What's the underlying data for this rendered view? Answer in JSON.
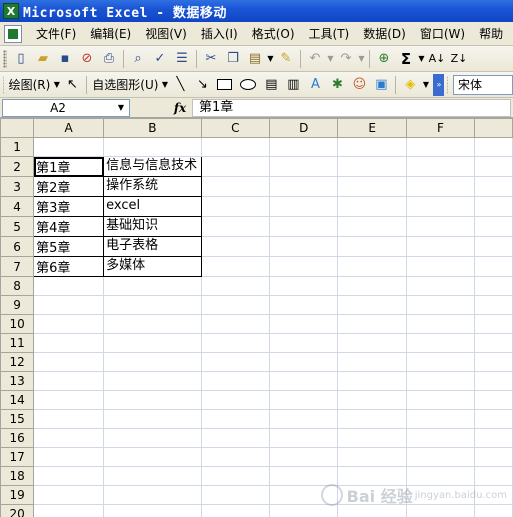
{
  "window": {
    "title": "Microsoft Excel - 数据移动",
    "app_icon": "excel-icon"
  },
  "menu": {
    "items": [
      "文件(F)",
      "编辑(E)",
      "视图(V)",
      "插入(I)",
      "格式(O)",
      "工具(T)",
      "数据(D)",
      "窗口(W)",
      "帮助"
    ]
  },
  "toolbar_standard": {
    "icons": [
      "new-icon",
      "open-icon",
      "save-icon",
      "permission-icon",
      "print-icon",
      "print-preview-icon",
      "spelling-icon",
      "research-icon",
      "cut-icon",
      "copy-icon",
      "paste-icon",
      "format-painter-icon",
      "undo-icon",
      "redo-icon",
      "hyperlink-icon",
      "autosum-icon",
      "sort-ascending-icon",
      "sort-descending-icon"
    ],
    "autosum_glyph": "Σ"
  },
  "toolbar_drawing": {
    "draw_label": "绘图(R)",
    "autoshapes_label": "自选图形(U)",
    "font_name": "宋体"
  },
  "formula_bar": {
    "name_box": "A2",
    "fx": "fx",
    "content": "第1章"
  },
  "sheet": {
    "columns": [
      "A",
      "B",
      "C",
      "D",
      "E",
      "F"
    ],
    "rows": [
      {
        "num": "1",
        "a": "",
        "b": ""
      },
      {
        "num": "2",
        "a": "第1章",
        "b": "信息与信息技术"
      },
      {
        "num": "3",
        "a": "第2章",
        "b": "操作系统"
      },
      {
        "num": "4",
        "a": "第3章",
        "b": "excel"
      },
      {
        "num": "5",
        "a": "第4章",
        "b": "基础知识"
      },
      {
        "num": "6",
        "a": "第5章",
        "b": "电子表格"
      },
      {
        "num": "7",
        "a": "第6章",
        "b": "多媒体"
      },
      {
        "num": "8",
        "a": "",
        "b": ""
      },
      {
        "num": "9",
        "a": "",
        "b": ""
      },
      {
        "num": "10",
        "a": "",
        "b": ""
      },
      {
        "num": "11",
        "a": "",
        "b": ""
      },
      {
        "num": "12",
        "a": "",
        "b": ""
      },
      {
        "num": "13",
        "a": "",
        "b": ""
      },
      {
        "num": "14",
        "a": "",
        "b": ""
      },
      {
        "num": "15",
        "a": "",
        "b": ""
      },
      {
        "num": "16",
        "a": "",
        "b": ""
      },
      {
        "num": "17",
        "a": "",
        "b": ""
      },
      {
        "num": "18",
        "a": "",
        "b": ""
      },
      {
        "num": "19",
        "a": "",
        "b": ""
      },
      {
        "num": "20",
        "a": "",
        "b": ""
      }
    ]
  },
  "watermark": {
    "text": "Bai 经验",
    "sub": "jingyan.baidu.com"
  }
}
